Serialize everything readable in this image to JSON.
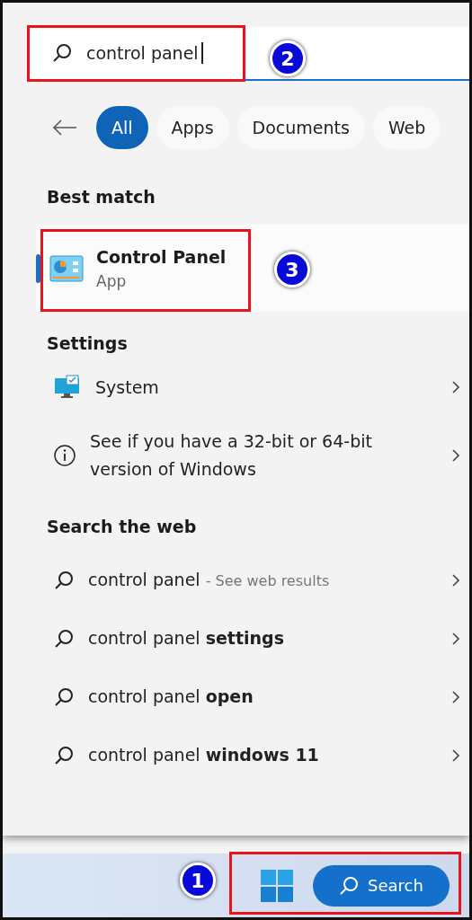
{
  "search": {
    "value": "control panel"
  },
  "filters": [
    {
      "label": "All",
      "selected": true
    },
    {
      "label": "Apps",
      "selected": false
    },
    {
      "label": "Documents",
      "selected": false
    },
    {
      "label": "Web",
      "selected": false
    }
  ],
  "best_match": {
    "heading": "Best match",
    "name": "Control Panel",
    "type": "App",
    "selected": true
  },
  "settings": {
    "heading": "Settings",
    "items": [
      {
        "kind": "system",
        "label": "System"
      },
      {
        "kind": "info",
        "label": "See if you have a 32-bit or 64-bit version of Windows"
      }
    ]
  },
  "web": {
    "heading": "Search the web",
    "items": [
      {
        "text": "control panel",
        "hint": "- See web results"
      },
      {
        "text": "control panel **settings**"
      },
      {
        "text": "control panel **open**"
      },
      {
        "text": "control panel **windows 11**"
      }
    ]
  },
  "taskbar": {
    "search_label": "Search"
  },
  "callouts": [
    {
      "number": "1"
    },
    {
      "number": "2"
    },
    {
      "number": "3"
    }
  ]
}
